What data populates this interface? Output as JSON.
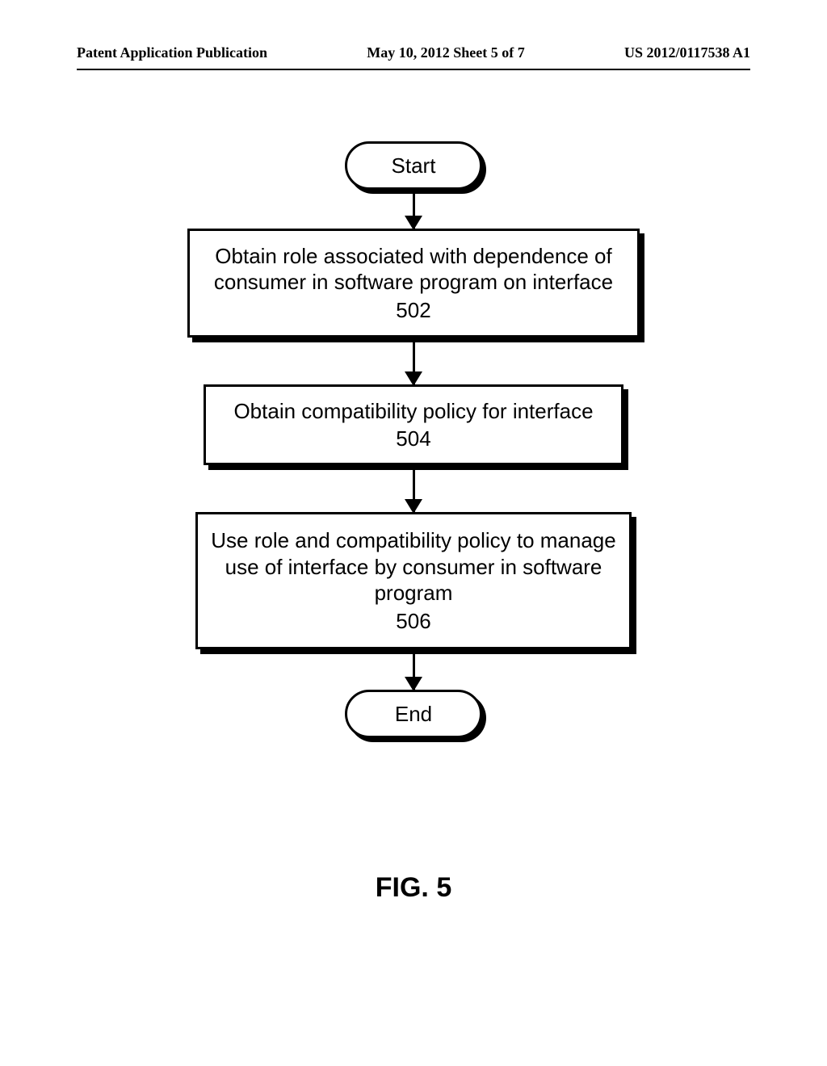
{
  "header": {
    "left": "Patent Application Publication",
    "center": "May 10, 2012  Sheet 5 of 7",
    "right": "US 2012/0117538 A1"
  },
  "flowchart": {
    "start": "Start",
    "step1": {
      "text": "Obtain role associated with dependence of consumer in software program on interface",
      "ref": "502"
    },
    "step2": {
      "text": "Obtain compatibility policy for interface",
      "ref": "504"
    },
    "step3": {
      "text": "Use role and compatibility policy to manage use of interface by consumer in software program",
      "ref": "506"
    },
    "end": "End"
  },
  "figure_label": "FIG. 5"
}
